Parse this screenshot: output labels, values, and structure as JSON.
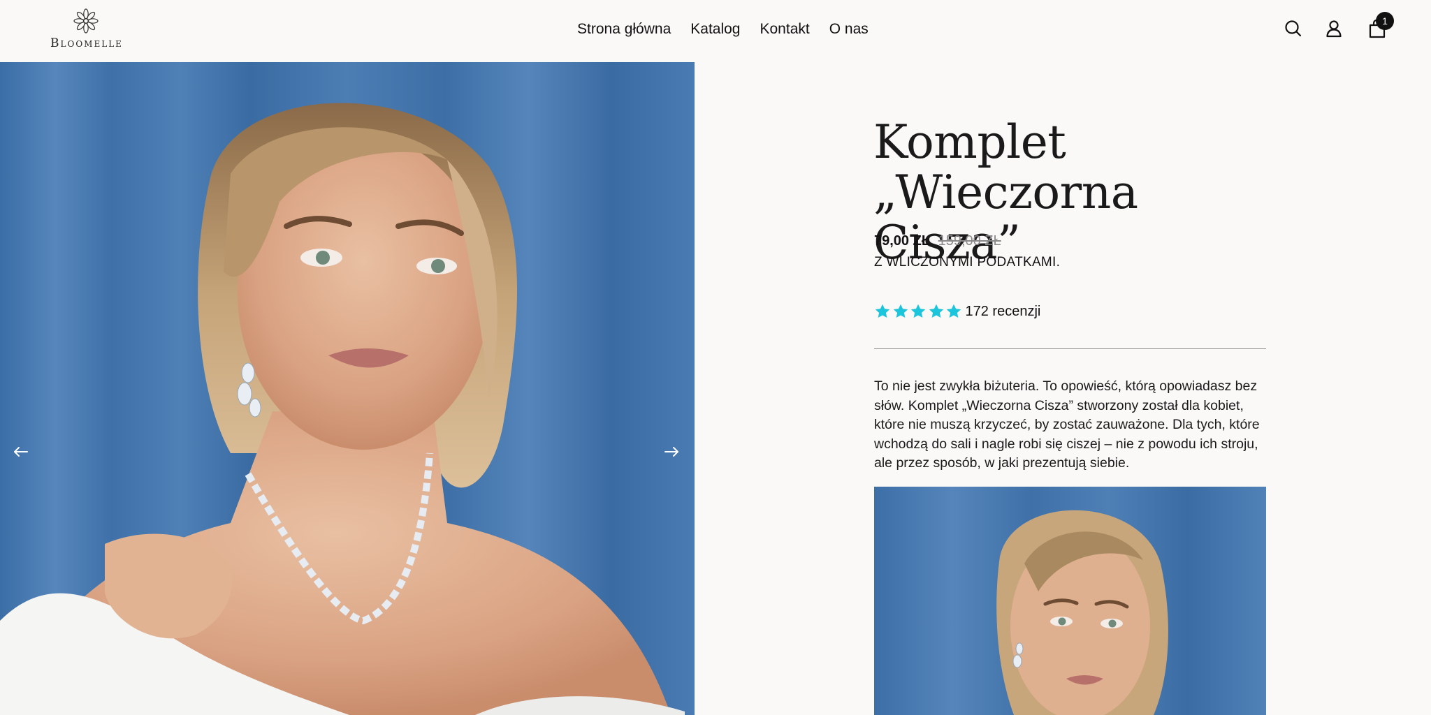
{
  "brand": {
    "name": "Bloomelle"
  },
  "nav": {
    "items": [
      {
        "label": "Strona główna"
      },
      {
        "label": "Katalog"
      },
      {
        "label": "Kontakt"
      },
      {
        "label": "O nas"
      }
    ]
  },
  "header_icons": {
    "search": "search-icon",
    "account": "user-icon",
    "cart": "shopping-bag-icon",
    "cart_count": "1"
  },
  "gallery": {
    "image": "portrait-woman-silver-jewelry-blue-curtain",
    "prev": "arrow-left-icon",
    "next": "arrow-right-icon"
  },
  "product": {
    "title_line1": "Komplet",
    "title_line2": "„Wieczorna Cisza”",
    "price": "79,00 ZŁ",
    "compare_price": "159,00 ZŁ",
    "tax_note": "Z WLICZONYMI PODATKAMI.",
    "rating": 5,
    "rating_color": "#1cc5dc",
    "reviews": "172 recenzji",
    "description": "To nie jest zwykła biżuteria. To opowieść, którą opowiadasz bez słów. Komplet „Wieczorna Cisza” stworzony został dla kobiet, które nie muszą krzyczeć, by zostać zauważone. Dla tych, które wchodzą do sali i nagle robi się ciszej – nie z powodu ich stroju, ale przez sposób, w jaki prezentują siebie."
  },
  "colors": {
    "background": "#faf9f7",
    "curtain_blue": "#4576ab",
    "text": "#111111"
  }
}
